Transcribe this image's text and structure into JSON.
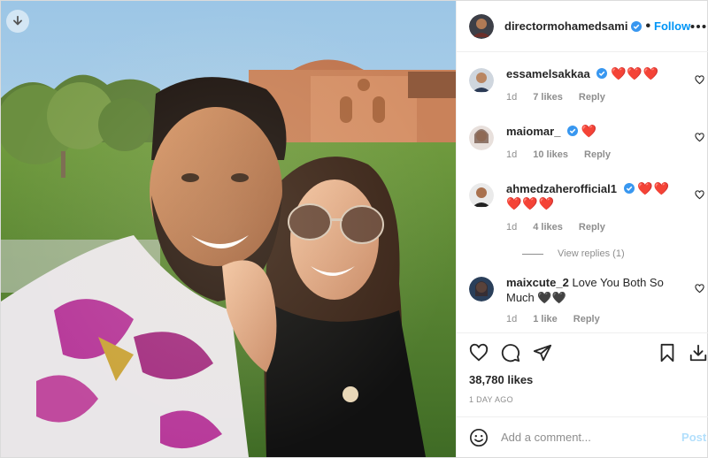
{
  "post": {
    "author": "directormohamedsami",
    "follow_label": "Follow",
    "separator": "•",
    "likes": "38,780 likes",
    "time": "1 DAY AGO"
  },
  "comments": [
    {
      "user": "essamelsakkaa",
      "verified": true,
      "text": "",
      "hearts": "❤️❤️❤️",
      "age": "1d",
      "likes": "7 likes",
      "reply": "Reply"
    },
    {
      "user": "maiomar_",
      "verified": true,
      "text": "",
      "hearts": "❤️",
      "age": "1d",
      "likes": "10 likes",
      "reply": "Reply"
    },
    {
      "user": "ahmedzaherofficial1",
      "verified": true,
      "text": "",
      "hearts": "❤️❤️❤️❤️❤️",
      "age": "1d",
      "likes": "4 likes",
      "reply": "Reply",
      "view_replies": "View replies (1)"
    },
    {
      "user": "maixcute_2",
      "verified": false,
      "text": "Love You Both So Much",
      "hearts": "🖤🖤",
      "age": "1d",
      "likes": "1 like",
      "reply": "Reply"
    }
  ],
  "composer": {
    "placeholder": "Add a comment...",
    "post_label": "Post"
  },
  "colors": {
    "accent": "#0095f6",
    "verified": "#3897f0",
    "heart": "#e41e3f",
    "post_disabled": "#b2dffc"
  },
  "icons": {
    "download": "download-arrow-icon",
    "more": "more-options-icon",
    "like": "heart-outline-icon",
    "comment": "comment-bubble-icon",
    "share": "paper-plane-icon",
    "save": "bookmark-icon",
    "save_post": "download-tray-icon",
    "emoji": "smiley-icon"
  }
}
